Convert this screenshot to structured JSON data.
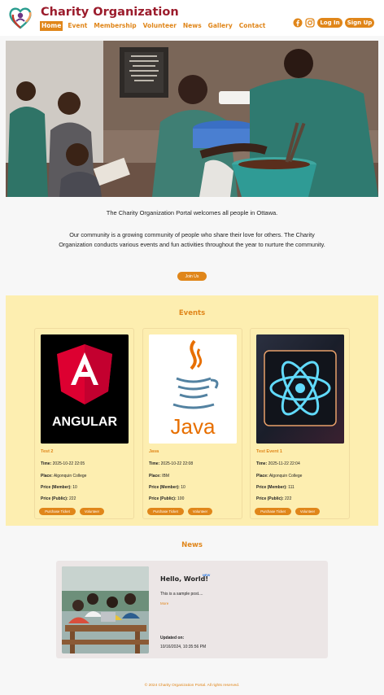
{
  "header": {
    "title": "Charity Organization",
    "nav": [
      "Home",
      "Event",
      "Membership",
      "Volunteer",
      "News",
      "Gallery",
      "Contact"
    ],
    "login_label": "Log In",
    "signup_label": "Sign Up",
    "social_icons": [
      "facebook-icon",
      "instagram-icon"
    ],
    "brand_color": "#9b1c2c",
    "accent_color": "#e0861a"
  },
  "intro": {
    "welcome": "The Charity Organization Portal welcomes all people in Ottawa.",
    "description": "Our community is a growing community of people who share their love for others. The Charity Organization conducts various events and fun activities throughout the year to nurture the community.",
    "join_label": "Join Us"
  },
  "events": {
    "title": "Events",
    "labels": {
      "time": "Time:",
      "place": "Place:",
      "price_member": "Price (Member):",
      "price_public": "Price (Public):",
      "purchase": "Purchase Ticket",
      "volunteer": "Volunteer"
    },
    "items": [
      {
        "title": "Test 2",
        "image_text": "ANGULAR",
        "time": "2025-10-22 22:05",
        "place": "Algonquin College",
        "price_member": "10",
        "price_public": "222"
      },
      {
        "title": "Java",
        "image_text": "Java",
        "time": "2025-10-22 22:08",
        "place": "IBM",
        "price_member": "10",
        "price_public": "100"
      },
      {
        "title": "Test Event 1",
        "image_text": "",
        "time": "2025-11-22 22:04",
        "place": "Algonquin College",
        "price_member": "111",
        "price_public": "222"
      }
    ]
  },
  "news": {
    "title": "News",
    "post": {
      "heading": "Hello, World!",
      "badge": "NEW",
      "body": "This is a sample post....",
      "more": "More",
      "updated_label": "Updated on:",
      "updated_value": "10/16/2024, 10:35:56 PM"
    }
  },
  "footer": "© 2024 Charity Organization Portal. All rights reserved."
}
